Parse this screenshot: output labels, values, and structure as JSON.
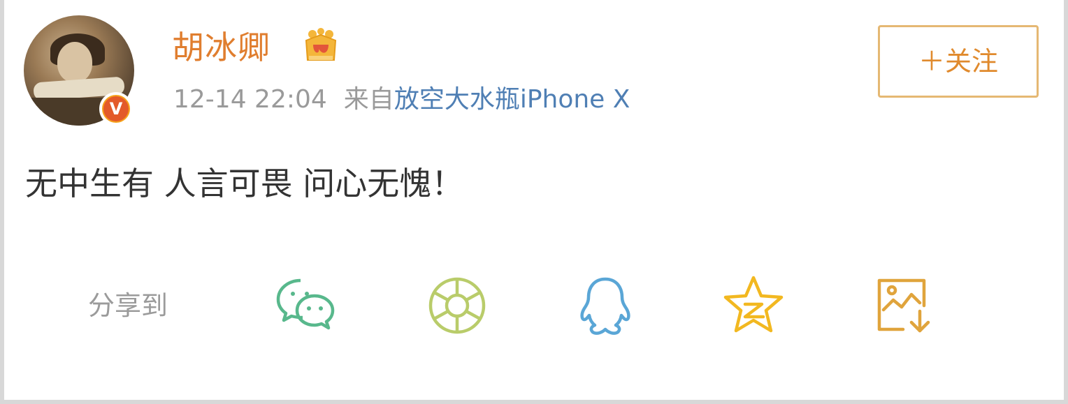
{
  "post": {
    "username": "胡冰卿",
    "timestamp": "12-14 22:04",
    "from_label": "来自",
    "source": "放空大水瓶iPhone X",
    "text": "无中生有 人言可畏 问心无愧！",
    "verified_badge": "V",
    "follow_label": "＋关注"
  },
  "share": {
    "label": "分享到",
    "targets": [
      "wechat-icon",
      "moments-icon",
      "qq-icon",
      "qzone-icon",
      "save-image-icon"
    ]
  },
  "colors": {
    "username": "#e07e2f",
    "source_link": "#4f7fb4",
    "follow_border": "#e5b873",
    "wechat": "#58b88c",
    "moments": "#b9cc6a",
    "qq": "#5aa6d6",
    "qzone": "#f2b820",
    "save": "#e0a43c"
  }
}
